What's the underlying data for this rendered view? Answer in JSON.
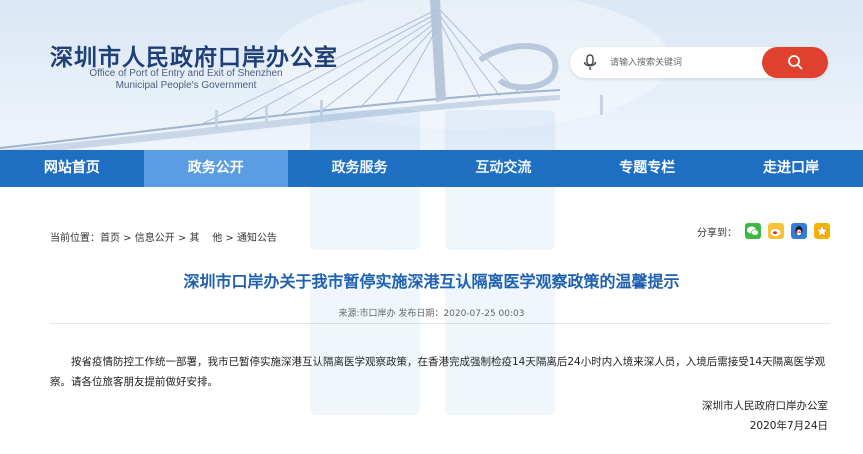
{
  "header": {
    "title_cn": "深圳市人民政府口岸办公室",
    "title_en_line1": "Office of Port of Entry and Exit of Shenzhen",
    "title_en_line2": "Municipal People's Government"
  },
  "search": {
    "placeholder": "请输入搜索关键词",
    "mic_icon": "microphone-icon",
    "button_icon": "search-icon"
  },
  "nav": {
    "items": [
      {
        "label": "网站首页"
      },
      {
        "label": "政务公开"
      },
      {
        "label": "政务服务"
      },
      {
        "label": "互动交流"
      },
      {
        "label": "专题专栏"
      },
      {
        "label": "走进口岸"
      }
    ],
    "active_index": 1,
    "colors": {
      "bar": "#1e6fc2",
      "active": "#5a9de3"
    }
  },
  "breadcrumb": {
    "prefix": "当前位置：",
    "items": [
      "首页",
      "信息公开",
      "其    他",
      "通知公告"
    ],
    "separator": " > "
  },
  "share": {
    "label": "分享到：",
    "icons": [
      "wechat-icon",
      "weibo-icon",
      "qq-icon",
      "qzone-icon"
    ]
  },
  "article": {
    "title": "深圳市口岸办关于我市暂停实施深港互认隔离医学观察政策的温馨提示",
    "meta": "来源:市口岸办  发布日期：2020-07-25 00:03",
    "body": "按省疫情防控工作统一部署，我市已暂停实施深港互认隔离医学观察政策，在香港完成强制检疫14天隔离后24小时内入境来深人员，入境后需接受14天隔离医学观察。请各位旅客朋友提前做好安排。",
    "signer": "深圳市人民政府口岸办公室",
    "date": "2020年7月24日",
    "title_color": "#1e5fb0"
  }
}
